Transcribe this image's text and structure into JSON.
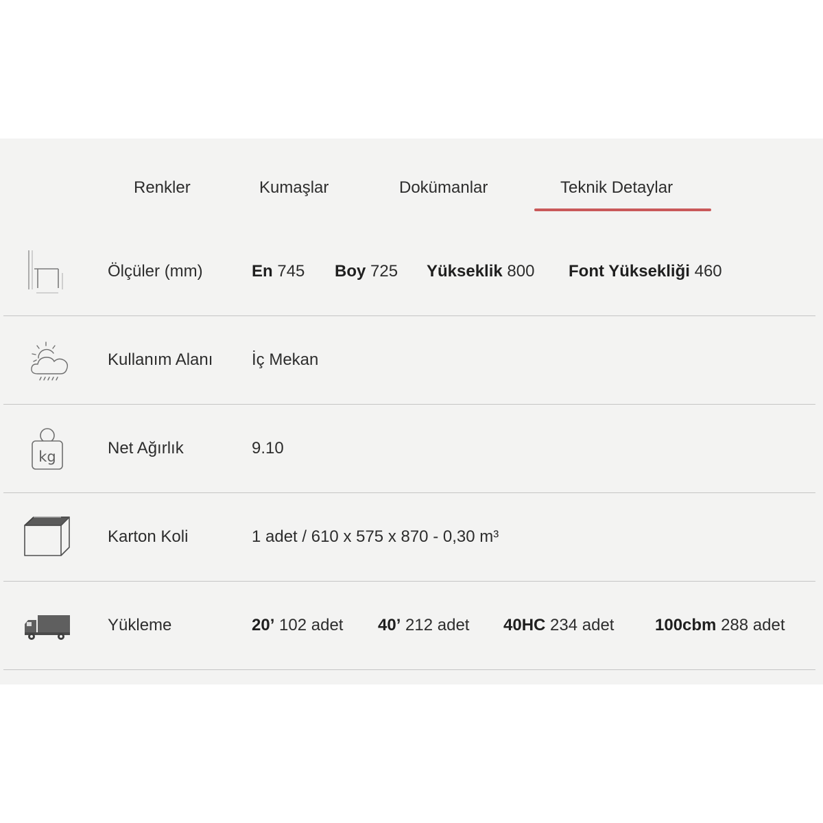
{
  "tabs": [
    {
      "label": "Renkler",
      "active": false
    },
    {
      "label": "Kumaşlar",
      "active": false
    },
    {
      "label": "Dokümanlar",
      "active": false
    },
    {
      "label": "Teknik Detaylar",
      "active": true
    }
  ],
  "accent_color": "#c9595a",
  "rows": [
    {
      "icon": "dimensions-icon",
      "label": "Ölçüler (mm)",
      "items": [
        {
          "key": "En",
          "value": "745"
        },
        {
          "key": "Boy",
          "value": "725"
        },
        {
          "key": "Yükseklik",
          "value": "800"
        },
        {
          "key": "Font Yüksekliği",
          "value": "460"
        }
      ]
    },
    {
      "icon": "weather-icon",
      "label": "Kullanım Alanı",
      "text": "İç Mekan"
    },
    {
      "icon": "weight-kg-icon",
      "label": "Net Ağırlık",
      "text": "9.10"
    },
    {
      "icon": "carton-box-icon",
      "label": "Karton Koli",
      "text": "1 adet / 610 x 575 x 870 - 0,30 m³"
    },
    {
      "icon": "truck-icon",
      "label": "Yükleme",
      "items": [
        {
          "key": "20’",
          "value": "102 adet"
        },
        {
          "key": "40’",
          "value": "212 adet"
        },
        {
          "key": "40HC",
          "value": "234 adet"
        },
        {
          "key": "100cbm",
          "value": "288 adet"
        }
      ]
    }
  ]
}
